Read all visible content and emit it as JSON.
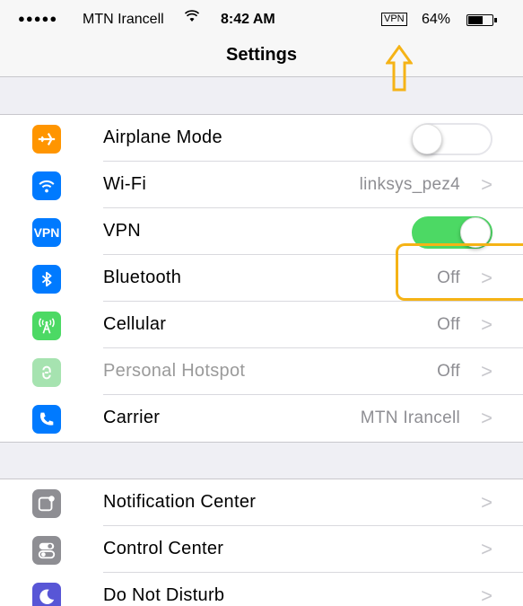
{
  "status": {
    "signal": "●●●●●",
    "carrier": "MTN Irancell",
    "wifi_icon": "wifi-icon",
    "time": "8:42 AM",
    "vpn": "VPN",
    "battery": "64%",
    "battery_level": 0.64
  },
  "nav": {
    "title": "Settings"
  },
  "colors": {
    "highlight": "#f5b316",
    "toggle_on": "#4cd964"
  },
  "group1": [
    {
      "label": "Airplane Mode",
      "icon": "airplane-icon",
      "color": "#ff9500",
      "toggle": "off"
    },
    {
      "label": "Wi-Fi",
      "icon": "wifi-icon",
      "color": "#007aff",
      "value": "linksys_pez4"
    },
    {
      "label": "VPN",
      "icon": "vpn-icon",
      "color": "#007aff",
      "badge": "VPN",
      "toggle": "on"
    },
    {
      "label": "Bluetooth",
      "icon": "bluetooth-icon",
      "color": "#007aff",
      "value": "Off"
    },
    {
      "label": "Cellular",
      "icon": "cellular-icon",
      "color": "#4cd964",
      "value": "Off"
    },
    {
      "label": "Personal Hotspot",
      "icon": "hotspot-icon",
      "color": "#a6e3b0",
      "value": "Off",
      "disabled": true
    },
    {
      "label": "Carrier",
      "icon": "phone-icon",
      "color": "#007aff",
      "value": "MTN Irancell"
    }
  ],
  "group2": [
    {
      "label": "Notification Center",
      "icon": "notification-icon",
      "color": "#8e8e93"
    },
    {
      "label": "Control Center",
      "icon": "toggles-icon",
      "color": "#8e8e93"
    },
    {
      "label": "Do Not Disturb",
      "icon": "moon-icon",
      "color": "#5856d6"
    }
  ]
}
